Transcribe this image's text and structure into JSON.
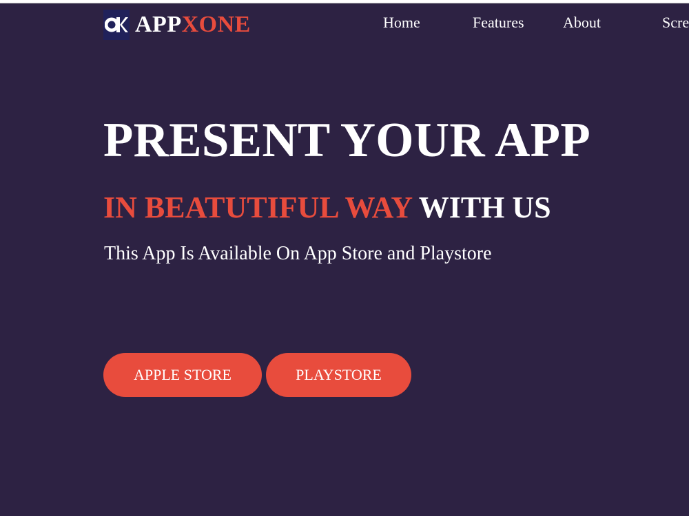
{
  "brand": {
    "name_part1": "APP",
    "name_part2": "XONE",
    "logo_icon": "ok-logo-icon"
  },
  "nav": {
    "items": [
      {
        "label": "Home"
      },
      {
        "label": "Features"
      },
      {
        "label": "About"
      },
      {
        "label": "Scre"
      }
    ]
  },
  "hero": {
    "title": "PRESENT YOUR APP",
    "subtitle_highlight": "IN BEATUTIFUL WAY",
    "subtitle_rest": "WITH US",
    "description": "This App Is Available On App Store and Playstore"
  },
  "buttons": {
    "apple": "APPLE STORE",
    "play": "PLAYSTORE"
  },
  "colors": {
    "background": "#2d2243",
    "accent": "#e84c3d",
    "text": "#ffffff",
    "logo_bg": "#20215a"
  }
}
